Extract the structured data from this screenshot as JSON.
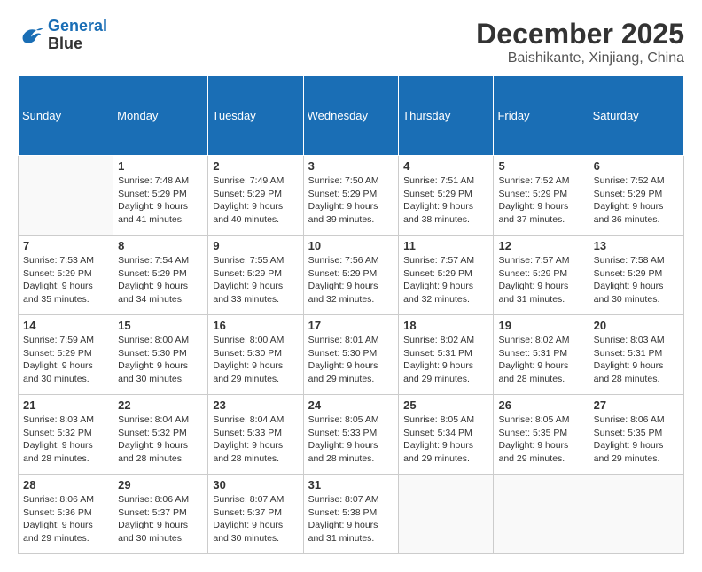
{
  "header": {
    "logo_line1": "General",
    "logo_line2": "Blue",
    "month_year": "December 2025",
    "location": "Baishikante, Xinjiang, China"
  },
  "weekdays": [
    "Sunday",
    "Monday",
    "Tuesday",
    "Wednesday",
    "Thursday",
    "Friday",
    "Saturday"
  ],
  "weeks": [
    [
      {
        "day": "",
        "info": ""
      },
      {
        "day": "1",
        "info": "Sunrise: 7:48 AM\nSunset: 5:29 PM\nDaylight: 9 hours\nand 41 minutes."
      },
      {
        "day": "2",
        "info": "Sunrise: 7:49 AM\nSunset: 5:29 PM\nDaylight: 9 hours\nand 40 minutes."
      },
      {
        "day": "3",
        "info": "Sunrise: 7:50 AM\nSunset: 5:29 PM\nDaylight: 9 hours\nand 39 minutes."
      },
      {
        "day": "4",
        "info": "Sunrise: 7:51 AM\nSunset: 5:29 PM\nDaylight: 9 hours\nand 38 minutes."
      },
      {
        "day": "5",
        "info": "Sunrise: 7:52 AM\nSunset: 5:29 PM\nDaylight: 9 hours\nand 37 minutes."
      },
      {
        "day": "6",
        "info": "Sunrise: 7:52 AM\nSunset: 5:29 PM\nDaylight: 9 hours\nand 36 minutes."
      }
    ],
    [
      {
        "day": "7",
        "info": "Sunrise: 7:53 AM\nSunset: 5:29 PM\nDaylight: 9 hours\nand 35 minutes."
      },
      {
        "day": "8",
        "info": "Sunrise: 7:54 AM\nSunset: 5:29 PM\nDaylight: 9 hours\nand 34 minutes."
      },
      {
        "day": "9",
        "info": "Sunrise: 7:55 AM\nSunset: 5:29 PM\nDaylight: 9 hours\nand 33 minutes."
      },
      {
        "day": "10",
        "info": "Sunrise: 7:56 AM\nSunset: 5:29 PM\nDaylight: 9 hours\nand 32 minutes."
      },
      {
        "day": "11",
        "info": "Sunrise: 7:57 AM\nSunset: 5:29 PM\nDaylight: 9 hours\nand 32 minutes."
      },
      {
        "day": "12",
        "info": "Sunrise: 7:57 AM\nSunset: 5:29 PM\nDaylight: 9 hours\nand 31 minutes."
      },
      {
        "day": "13",
        "info": "Sunrise: 7:58 AM\nSunset: 5:29 PM\nDaylight: 9 hours\nand 30 minutes."
      }
    ],
    [
      {
        "day": "14",
        "info": "Sunrise: 7:59 AM\nSunset: 5:29 PM\nDaylight: 9 hours\nand 30 minutes."
      },
      {
        "day": "15",
        "info": "Sunrise: 8:00 AM\nSunset: 5:30 PM\nDaylight: 9 hours\nand 30 minutes."
      },
      {
        "day": "16",
        "info": "Sunrise: 8:00 AM\nSunset: 5:30 PM\nDaylight: 9 hours\nand 29 minutes."
      },
      {
        "day": "17",
        "info": "Sunrise: 8:01 AM\nSunset: 5:30 PM\nDaylight: 9 hours\nand 29 minutes."
      },
      {
        "day": "18",
        "info": "Sunrise: 8:02 AM\nSunset: 5:31 PM\nDaylight: 9 hours\nand 29 minutes."
      },
      {
        "day": "19",
        "info": "Sunrise: 8:02 AM\nSunset: 5:31 PM\nDaylight: 9 hours\nand 28 minutes."
      },
      {
        "day": "20",
        "info": "Sunrise: 8:03 AM\nSunset: 5:31 PM\nDaylight: 9 hours\nand 28 minutes."
      }
    ],
    [
      {
        "day": "21",
        "info": "Sunrise: 8:03 AM\nSunset: 5:32 PM\nDaylight: 9 hours\nand 28 minutes."
      },
      {
        "day": "22",
        "info": "Sunrise: 8:04 AM\nSunset: 5:32 PM\nDaylight: 9 hours\nand 28 minutes."
      },
      {
        "day": "23",
        "info": "Sunrise: 8:04 AM\nSunset: 5:33 PM\nDaylight: 9 hours\nand 28 minutes."
      },
      {
        "day": "24",
        "info": "Sunrise: 8:05 AM\nSunset: 5:33 PM\nDaylight: 9 hours\nand 28 minutes."
      },
      {
        "day": "25",
        "info": "Sunrise: 8:05 AM\nSunset: 5:34 PM\nDaylight: 9 hours\nand 29 minutes."
      },
      {
        "day": "26",
        "info": "Sunrise: 8:05 AM\nSunset: 5:35 PM\nDaylight: 9 hours\nand 29 minutes."
      },
      {
        "day": "27",
        "info": "Sunrise: 8:06 AM\nSunset: 5:35 PM\nDaylight: 9 hours\nand 29 minutes."
      }
    ],
    [
      {
        "day": "28",
        "info": "Sunrise: 8:06 AM\nSunset: 5:36 PM\nDaylight: 9 hours\nand 29 minutes."
      },
      {
        "day": "29",
        "info": "Sunrise: 8:06 AM\nSunset: 5:37 PM\nDaylight: 9 hours\nand 30 minutes."
      },
      {
        "day": "30",
        "info": "Sunrise: 8:07 AM\nSunset: 5:37 PM\nDaylight: 9 hours\nand 30 minutes."
      },
      {
        "day": "31",
        "info": "Sunrise: 8:07 AM\nSunset: 5:38 PM\nDaylight: 9 hours\nand 31 minutes."
      },
      {
        "day": "",
        "info": ""
      },
      {
        "day": "",
        "info": ""
      },
      {
        "day": "",
        "info": ""
      }
    ]
  ]
}
